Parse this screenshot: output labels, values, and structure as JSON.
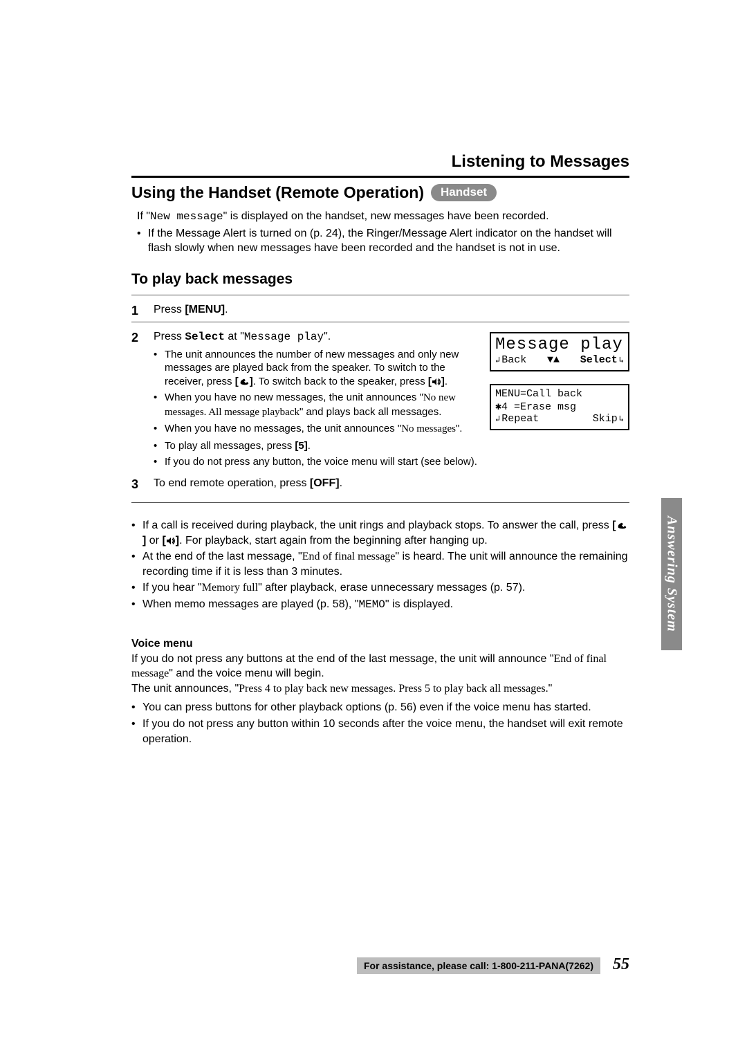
{
  "header": {
    "section": "Listening to Messages"
  },
  "title": {
    "text": "Using the Handset (Remote Operation)",
    "pill": "Handset"
  },
  "intro": {
    "line1_pre": "If \"",
    "line1_mono": "New message",
    "line1_post": "\" is displayed on the handset, new messages have been recorded.",
    "bullet1": "If the Message Alert is turned on (p. 24), the Ringer/Message Alert indicator on the handset will flash slowly when new messages have been recorded and the handset is not in use."
  },
  "playback": {
    "heading": "To play back messages",
    "step1": {
      "pre": "Press ",
      "bold": "[MENU]",
      "post": "."
    },
    "step2": {
      "pre": "Press ",
      "sel": "Select",
      "mid": " at \"",
      "mono": "Message play",
      "post": "\".",
      "subs": [
        {
          "pre": "The unit announces the number of new messages and only new messages are played back from the speaker. To switch to the receiver, press ",
          "b1": "[",
          "icon1": "talk",
          "b1c": "]",
          "mid": ". To switch back to the speaker, press ",
          "b2": "[",
          "icon2": "speaker",
          "b2c": "]",
          "post": "."
        },
        {
          "pre": "When you have no new messages, the unit announces \"",
          "serif": "No new messages. All message playback",
          "post": "\" and plays back all messages."
        },
        {
          "pre": "When you have no messages, the unit announces \"",
          "serif": "No messages",
          "post": "\"."
        },
        {
          "pre": "To play all messages, press ",
          "bold": "[5]",
          "post": "."
        },
        {
          "text": "If you do not press any button, the voice menu will start (see below)."
        }
      ]
    },
    "step3": {
      "pre": "To end remote operation, press ",
      "bold": "[OFF]",
      "post": "."
    }
  },
  "lcd1": {
    "title": "Message play",
    "left": "Back",
    "mid_arrows": "▼▲",
    "right": "Select"
  },
  "lcd2": {
    "l1": "MENU=Call back",
    "l2": " ✱4 =Erase msg",
    "left": "Repeat",
    "right": "Skip"
  },
  "notes": [
    {
      "pre": "If a call is received during playback, the unit rings and playback stops. To answer the call, press ",
      "b1": "[",
      "icon1": "talk",
      "b1c": "]",
      "or": " or ",
      "b2": "[",
      "icon2": "speaker",
      "b2c": "]",
      "post": ". For playback, start again from the beginning after hanging up."
    },
    {
      "pre": "At the end of the last message, \"",
      "serif": "End of final message",
      "post": "\" is heard. The unit will announce the remaining recording time if it is less than 3 minutes."
    },
    {
      "pre": "If you hear \"",
      "serif": "Memory full",
      "post": "\" after playback, erase unnecessary messages (p. 57)."
    },
    {
      "pre": "When memo messages are played (p. 58), \"",
      "mono": "MEMO",
      "post": "\" is displayed."
    }
  ],
  "voicemenu": {
    "heading": "Voice menu",
    "p1_pre": "If you do not press any buttons at the end of the last message, the unit will announce \"",
    "p1_serif": "End of final message",
    "p1_post": "\" and the voice menu will begin.",
    "p2_pre": "The unit announces, \"",
    "p2_serif": "Press 4 to play back new messages. Press 5 to play back all messages.",
    "p2_post": "\"",
    "bullets": [
      "You can press buttons for other playback options (p. 56) even if the voice menu has started.",
      "If you do not press any button within 10 seconds after the voice menu, the handset will exit remote operation."
    ]
  },
  "footer": {
    "assist": "For assistance, please call: 1-800-211-PANA(7262)",
    "page": "55"
  },
  "sidetab": "Answering System"
}
